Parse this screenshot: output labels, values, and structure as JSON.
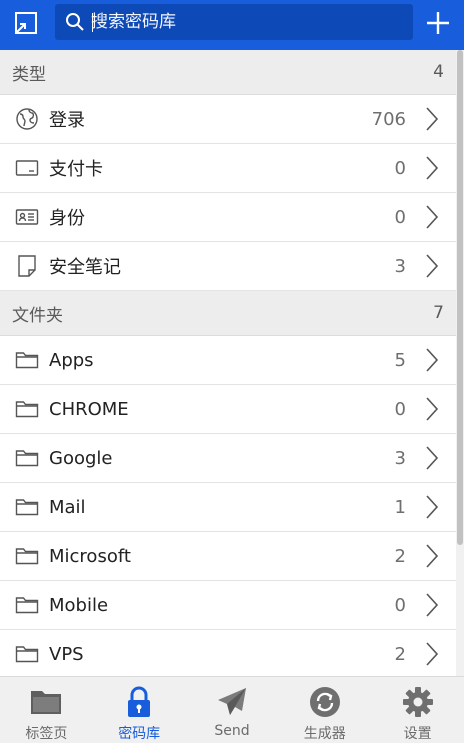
{
  "header": {
    "search_placeholder": "搜索密码库"
  },
  "types": {
    "title": "类型",
    "count": "4",
    "items": [
      {
        "label": "登录",
        "count": "706"
      },
      {
        "label": "支付卡",
        "count": "0"
      },
      {
        "label": "身份",
        "count": "0"
      },
      {
        "label": "安全笔记",
        "count": "3"
      }
    ]
  },
  "folders": {
    "title": "文件夹",
    "count": "7",
    "items": [
      {
        "label": "Apps",
        "count": "5"
      },
      {
        "label": "CHROME",
        "count": "0"
      },
      {
        "label": "Google",
        "count": "3"
      },
      {
        "label": "Mail",
        "count": "1"
      },
      {
        "label": "Microsoft",
        "count": "2"
      },
      {
        "label": "Mobile",
        "count": "0"
      },
      {
        "label": "VPS",
        "count": "2"
      }
    ]
  },
  "tabs": [
    {
      "label": "标签页",
      "icon": "folder-icon"
    },
    {
      "label": "密码库",
      "icon": "lock-icon"
    },
    {
      "label": "Send",
      "icon": "paper-plane-icon"
    },
    {
      "label": "生成器",
      "icon": "refresh-icon"
    },
    {
      "label": "设置",
      "icon": "gear-icon"
    }
  ],
  "colors": {
    "brand": "#175DDC",
    "tab_inactive": "#6b6b6b"
  }
}
